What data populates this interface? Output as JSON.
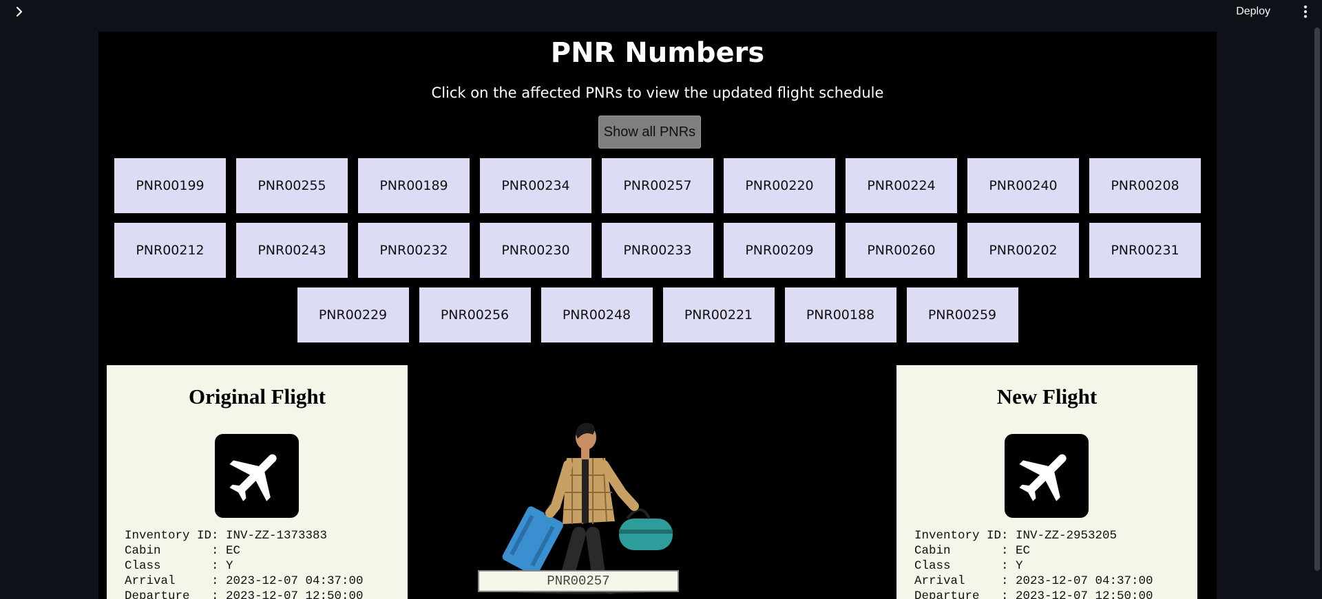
{
  "topbar": {
    "deploy_label": "Deploy"
  },
  "page": {
    "title": "PNR Numbers",
    "subtitle": "Click on the affected PNRs to view the updated flight schedule",
    "show_all_label": "Show all PNRs"
  },
  "pnr_rows": [
    [
      "PNR00199",
      "PNR00255",
      "PNR00189",
      "PNR00234",
      "PNR00257",
      "PNR00220",
      "PNR00224",
      "PNR00240",
      "PNR00208"
    ],
    [
      "PNR00212",
      "PNR00243",
      "PNR00232",
      "PNR00230",
      "PNR00233",
      "PNR00209",
      "PNR00260",
      "PNR00202",
      "PNR00231"
    ],
    [
      "PNR00229",
      "PNR00256",
      "PNR00248",
      "PNR00221",
      "PNR00188",
      "PNR00259"
    ]
  ],
  "original_flight": {
    "title": "Original Flight",
    "icon": "airplane-icon",
    "lines": [
      "Inventory ID: INV-ZZ-1373383",
      "Cabin       : EC",
      "Class       : Y",
      "Arrival     : 2023-12-07 04:37:00",
      "Departure   : 2023-12-07 12:50:00"
    ]
  },
  "new_flight": {
    "title": "New Flight",
    "icon": "airplane-icon",
    "lines": [
      "Inventory ID: INV-ZZ-2953205",
      "Cabin       : EC",
      "Class       : Y",
      "Arrival     : 2023-12-07 04:37:00",
      "Departure   : 2023-12-07 12:50:00"
    ]
  },
  "selected_pnr": "PNR00257",
  "colors": {
    "app_bg": "#0e1117",
    "panel_bg": "#000000",
    "pnr_button_bg": "#dcddf5",
    "card_bg": "#f4f6ea",
    "show_all_bg": "#7f7f7f"
  }
}
